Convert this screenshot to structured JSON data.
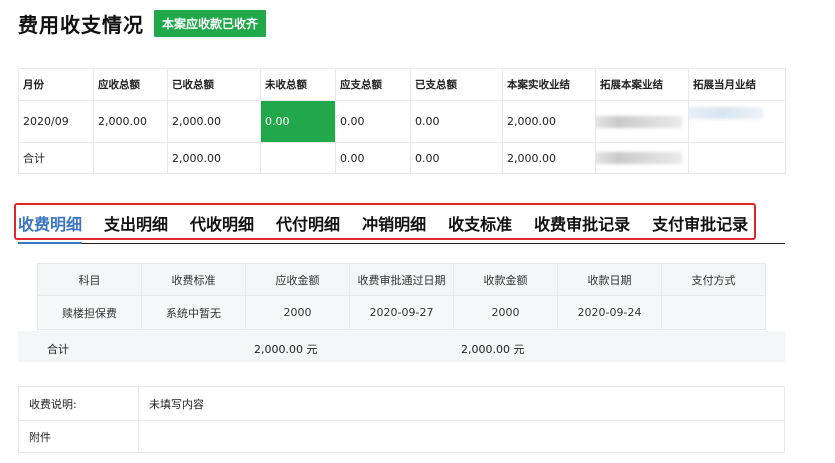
{
  "header": {
    "title": "费用收支情况",
    "badge": "本案应收款已收齐"
  },
  "summary": {
    "columns": [
      "月份",
      "应收总额",
      "已收总额",
      "未收总额",
      "应支总额",
      "已支总额",
      "本案实收业结",
      "拓展本案业结",
      "拓展当月业结"
    ],
    "rows": [
      [
        "2020/09",
        "2,000.00",
        "2,000.00",
        "0.00",
        "0.00",
        "0.00",
        "2,000.00",
        "",
        ""
      ],
      [
        "合计",
        "",
        "2,000.00",
        "",
        "0.00",
        "0.00",
        "2,000.00",
        "",
        ""
      ]
    ]
  },
  "tabs": [
    "收费明细",
    "支出明细",
    "代收明细",
    "代付明细",
    "冲销明细",
    "收支标准",
    "收费审批记录",
    "支付审批记录"
  ],
  "detail": {
    "columns": [
      "科目",
      "收费标准",
      "应收金额",
      "收费审批通过日期",
      "收款金额",
      "收款日期",
      "支付方式"
    ],
    "rows": [
      [
        "赎楼担保费",
        "系统中暂无",
        "2000",
        "2020-09-27",
        "2000",
        "2020-09-24",
        ""
      ]
    ]
  },
  "total_row": {
    "label": "合计",
    "receivable": "2,000.00 元",
    "received": "2,000.00 元"
  },
  "remarks": {
    "note_label": "收费说明:",
    "note_value": "未填写内容",
    "attach_label": "附件",
    "attach_value": ""
  },
  "colors": {
    "accent_green": "#21a84b",
    "tab_active": "#3b76c4",
    "highlight_border": "#e0262f"
  }
}
